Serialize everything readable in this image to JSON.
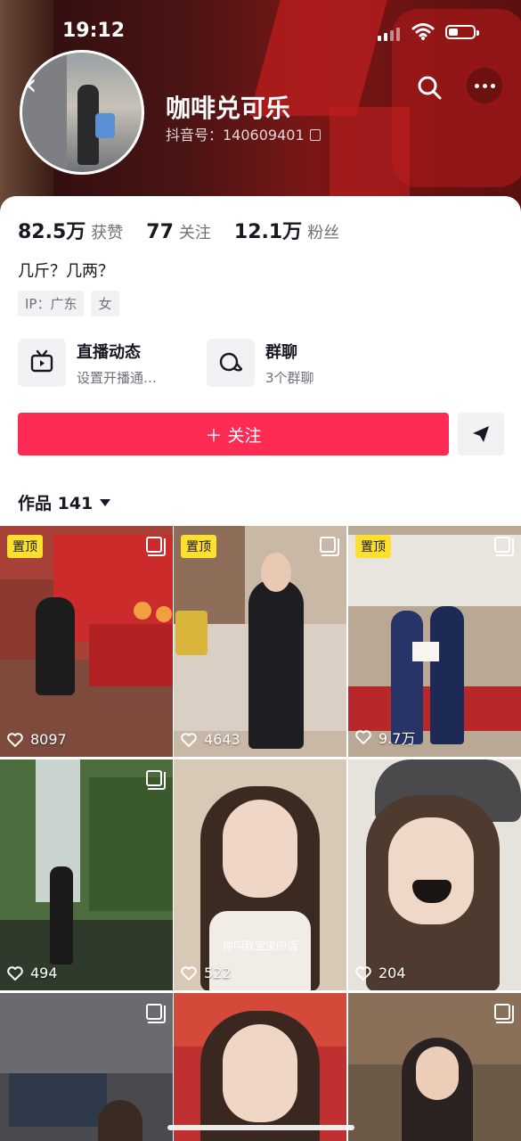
{
  "status_bar": {
    "time": "19:12"
  },
  "profile": {
    "name": "咖啡兑可乐",
    "douyin_id": "抖音号：140609401",
    "stats": [
      {
        "num": "82.5万",
        "label": "获赞"
      },
      {
        "num": "77",
        "label": "关注"
      },
      {
        "num": "12.1万",
        "label": "粉丝"
      }
    ],
    "bio": "几斤？几两？",
    "tags": [
      "IP：广东",
      "女"
    ]
  },
  "features": [
    {
      "title": "直播动态",
      "subtitle": "设置开播通…",
      "icon": "tv-icon"
    },
    {
      "title": "群聊",
      "subtitle": "3个群聊",
      "icon": "chat-bubble-icon"
    }
  ],
  "actions": {
    "follow_label": "＋ 关注",
    "share_icon": "send-icon"
  },
  "works_tab": {
    "label": "作品 141"
  },
  "grid": [
    {
      "pinned": "置顶",
      "likes": "8097",
      "caption": "",
      "multi": true
    },
    {
      "pinned": "置顶",
      "likes": "4643",
      "caption": "",
      "multi": true
    },
    {
      "pinned": "置顶",
      "likes": "9.7万",
      "caption": "",
      "multi": true
    },
    {
      "pinned": "",
      "likes": "494",
      "caption": "",
      "multi": true
    },
    {
      "pinned": "",
      "likes": "522",
      "caption": "你叫我宝宝的话",
      "multi": false
    },
    {
      "pinned": "",
      "likes": "204",
      "caption": "",
      "multi": false
    },
    {
      "pinned": "",
      "likes": "",
      "caption": "",
      "multi": true
    },
    {
      "pinned": "",
      "likes": "",
      "caption": "",
      "multi": false
    },
    {
      "pinned": "",
      "likes": "",
      "caption": "",
      "multi": true
    }
  ],
  "colors": {
    "accent": "#fe2c55",
    "pin_badge": "#fddf2e",
    "text_secondary": "#6f7078"
  }
}
